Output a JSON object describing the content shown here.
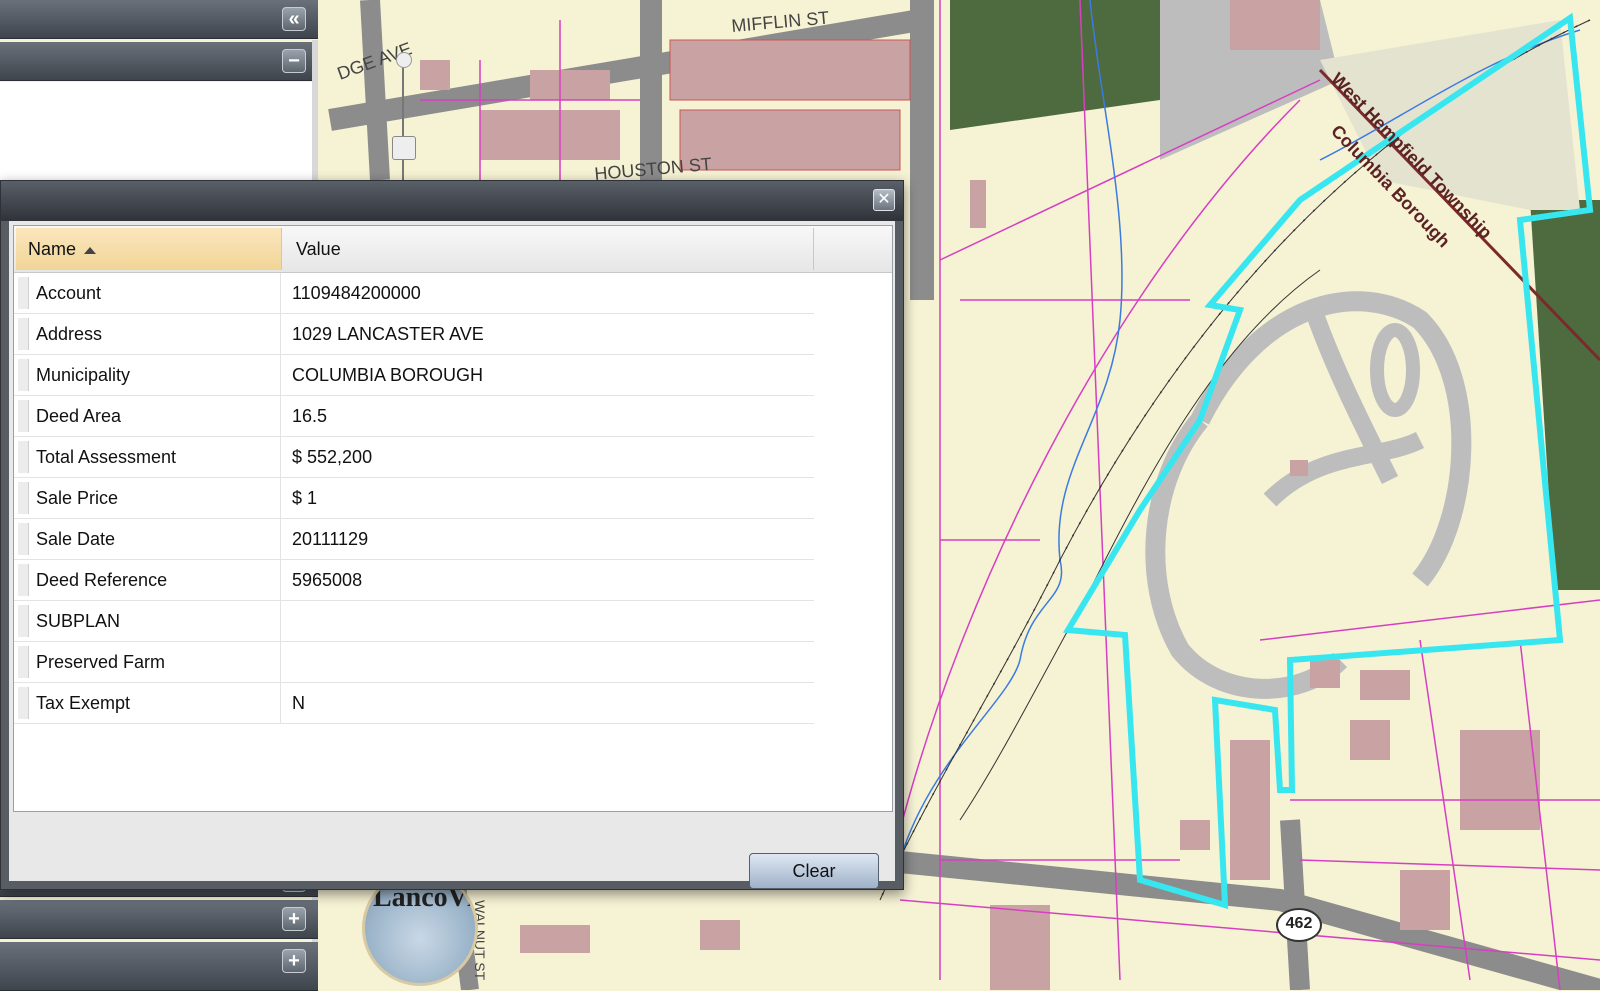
{
  "map": {
    "street_labels": [
      "MIFFLIN ST",
      "HOUSTON ST",
      "DGE AVE",
      "WALNUT ST"
    ],
    "boundary_labels": [
      "West Hempfield Township",
      "Columbia Borough"
    ],
    "route_badge": "462",
    "logo_text": "LancoView"
  },
  "left_panel": {
    "collapse_icon": "double-chevron-left-icon",
    "minimize_icon": "minus-icon",
    "expand_icon": "plus-icon"
  },
  "dialog": {
    "close_icon": "close-icon",
    "columns": {
      "name": "Name",
      "value": "Value"
    },
    "rows": [
      {
        "name": "Account",
        "value": "1109484200000"
      },
      {
        "name": "Address",
        "value": "1029 LANCASTER AVE"
      },
      {
        "name": "Municipality",
        "value": "COLUMBIA BOROUGH"
      },
      {
        "name": "Deed Area",
        "value": "16.5"
      },
      {
        "name": "Total Assessment",
        "value": "$ 552,200"
      },
      {
        "name": "Sale Price",
        "value": "$ 1"
      },
      {
        "name": "Sale Date",
        "value": "20111129"
      },
      {
        "name": "Deed Reference",
        "value": "5965008"
      },
      {
        "name": "SUBPLAN",
        "value": ""
      },
      {
        "name": "Preserved Farm",
        "value": ""
      },
      {
        "name": "Tax Exempt",
        "value": "N"
      }
    ],
    "clear_label": "Clear"
  },
  "colors": {
    "parcel_boundary": "#d63fc2",
    "selected_parcel": "#38e6f0",
    "water": "#3b7be0",
    "road": "#8c8c8c",
    "building": "#c9a3a3",
    "forest": "#4e6b3f",
    "land": "#f6f2d4"
  }
}
